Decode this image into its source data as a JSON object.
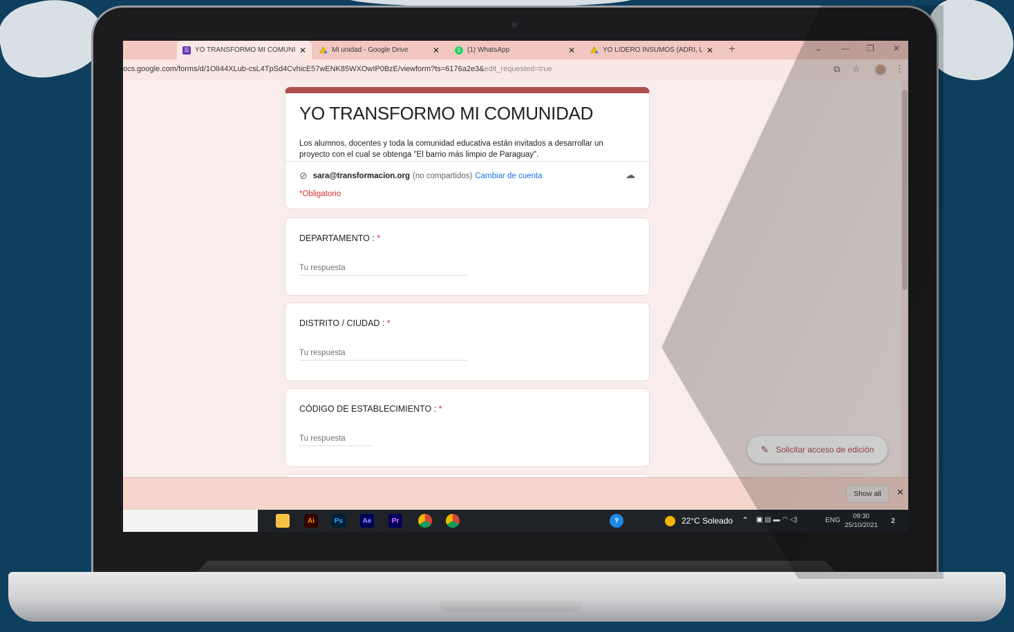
{
  "browser": {
    "tabs": [
      {
        "label": "YO TRANSFORMO MI COMUNIDA",
        "icon": "google-forms-icon",
        "active": true
      },
      {
        "label": "Mi unidad - Google Drive",
        "icon": "google-drive-icon",
        "active": false
      },
      {
        "label": "(1) WhatsApp",
        "icon": "whatsapp-icon",
        "active": false
      },
      {
        "label": "YO LIDERO INSUMOS (ADRI, LIN",
        "icon": "google-drive-icon",
        "active": false
      }
    ],
    "new_tab": "+",
    "url_main": "ocs.google.com/forms/d/1OlI44XLub-csL4TpSd4CvhicE57wENK85WXOwIP0BzE/viewform?ts=6176a2e3&",
    "url_dim": "edit_requested=true"
  },
  "form": {
    "title": "YO TRANSFORMO MI COMUNIDAD",
    "description": "Los alumnos, docentes y toda la comunidad educativa están invitados a desarrollar un proyecto con el cual se obtenga \"El barrio más limpio de Paraguay\".",
    "account_email": "sara@transformacion.org",
    "account_note": "(no compartidos)",
    "switch_account": "Cambiar de cuenta",
    "required_note": "*Obligatorio",
    "questions": [
      {
        "label": "DEPARTAMENTO :",
        "required": "*",
        "placeholder": "Tu respuesta"
      },
      {
        "label": "DISTRITO / CIUDAD :",
        "required": "*",
        "placeholder": "Tu respuesta"
      },
      {
        "label": "CÓDIGO DE ESTABLECIMIENTO :",
        "required": "*",
        "placeholder": "Tu respuesta"
      }
    ],
    "request_edit": "Solicitar acceso de edición"
  },
  "downloads": {
    "show_all": "Show all",
    "close": "✕"
  },
  "taskbar": {
    "apps": [
      "file-explorer-icon",
      "illustrator-icon",
      "photoshop-icon",
      "after-effects-icon",
      "premiere-icon",
      "chrome-icon",
      "chrome-icon"
    ],
    "app_labels": {
      "ai": "Ai",
      "ps": "Ps",
      "ae": "Ae",
      "pr": "Pr"
    },
    "weather": "22°C  Soleado",
    "language": "ENG",
    "time": "09:30",
    "date": "25/10/2021",
    "notifications": "2"
  },
  "colors": {
    "form_accent": "#b04e4e",
    "background": "#0e3f5e",
    "link": "#1a73e8",
    "required": "#d93025"
  }
}
